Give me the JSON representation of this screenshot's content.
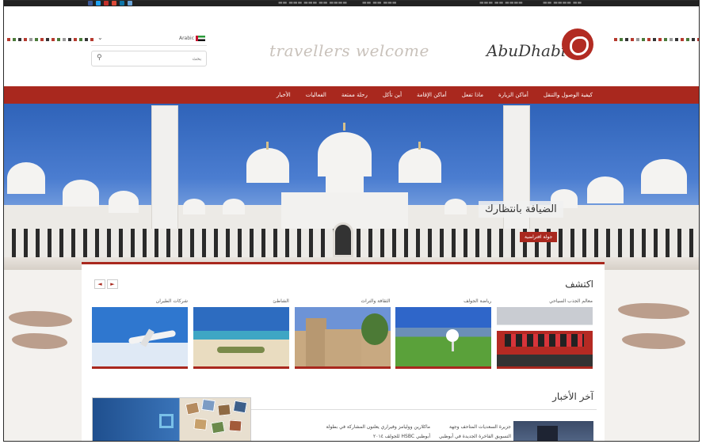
{
  "topbar": {
    "drawer_toggle": "^"
  },
  "header": {
    "language": "Arabic",
    "search_placeholder": "بحث",
    "tagline": "travellers welcome",
    "logo_text": "AbuDhabi"
  },
  "nav": {
    "items": [
      "كيفية الوصول والتنقل",
      "أماكن الزيارة",
      "ماذا تفعل",
      "أماكن الإقامة",
      "أين تأكل",
      "رحلة ممتعة",
      "الفعاليات",
      "الأخبار"
    ]
  },
  "hero": {
    "caption": "الضيافة بانتظارك",
    "cta": "جولة افتراضية"
  },
  "discover": {
    "title": "اكتشف",
    "pager": [
      "◄",
      "►"
    ],
    "thumbs": [
      {
        "caption": "معالم الجذب السياحي",
        "image": "formula-one-building"
      },
      {
        "caption": "رياضة الجولف",
        "image": "golf-course"
      },
      {
        "caption": "الثقافة والتراث",
        "image": "heritage-fort"
      },
      {
        "caption": "الشاطئ",
        "image": "beach"
      },
      {
        "caption": "شركات الطيران",
        "image": "airplane"
      }
    ]
  },
  "news": {
    "title": "آخر الأخبار",
    "item1": "جزيرة السعديات المتاحف وجهة التسويق الفاخرة الجديدة في أبوظبي",
    "item2": "ماكلارين ووليامز وفيراري يعلنون المشاركة في بطولة أبوظبي HSBC للجولف ٢٠١٤"
  },
  "colors": {
    "brand_red": "#a9281e",
    "topbar": "#222222"
  }
}
